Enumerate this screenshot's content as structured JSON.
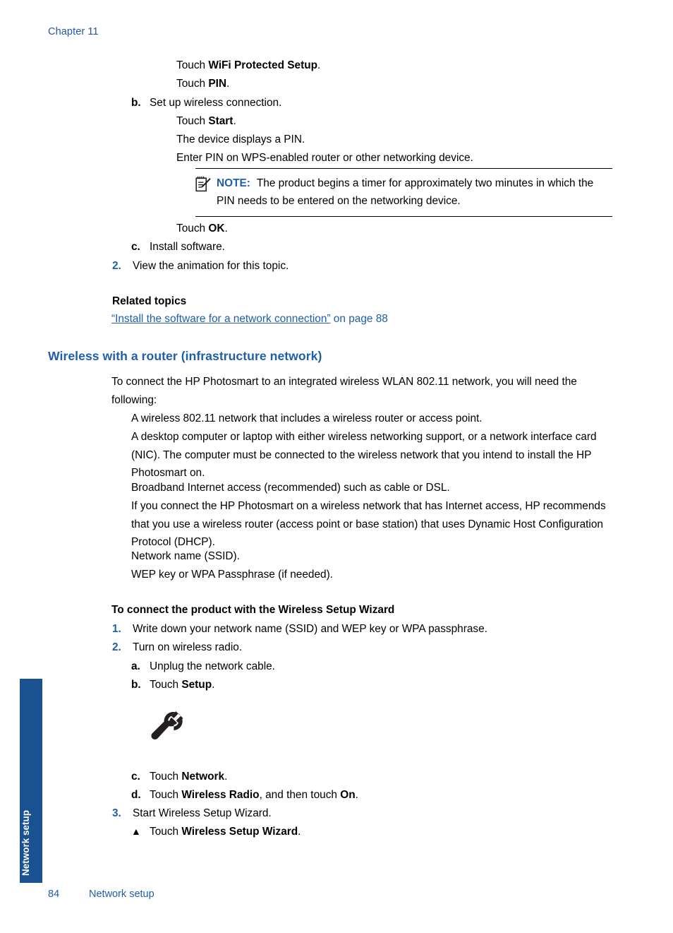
{
  "header": {
    "chapter": "Chapter 11"
  },
  "side_tab": {
    "label": "Network setup",
    "color": "#1A5190"
  },
  "colors": {
    "heading_blue": "#1F5FA9",
    "link_blue": "#1F5FA9",
    "chapter_blue": "#2156A5",
    "tab_blue": "#1A5190"
  },
  "top_steps": {
    "line_touch_wps": {
      "prefix": "Touch ",
      "bold": "WiFi Protected Setup",
      "suffix": "."
    },
    "line_touch_pin": {
      "prefix": "Touch ",
      "bold": "PIN",
      "suffix": "."
    },
    "step_b": {
      "marker": "b.",
      "text": "Set up wireless connection."
    },
    "line_touch_start": {
      "prefix": "Touch ",
      "bold": "Start",
      "suffix": "."
    },
    "line_device_pin": "The device displays a PIN.",
    "line_enter_pin": "Enter PIN on WPS-enabled router or other networking device.",
    "line_touch_ok": {
      "prefix": "Touch ",
      "bold": "OK",
      "suffix": "."
    },
    "step_c": {
      "marker": "c.",
      "text": "Install software."
    },
    "step_2": {
      "marker": "2.",
      "text": "View the animation for this topic."
    }
  },
  "note": {
    "icon": "note-pencil-icon",
    "label": "NOTE:",
    "text": "The product begins a timer for approximately two minutes in which the PIN needs to be entered on the networking device."
  },
  "related_topics": {
    "heading": "Related topics",
    "link_text": "“Install the software for a network connection”",
    "link_suffix": " on page 88"
  },
  "section": {
    "heading": "Wireless with a router (infrastructure network)",
    "intro": "To connect the HP Photosmart to an integrated wireless WLAN 802.11 network, you will need the following:",
    "requirements": [
      "A wireless 802.11 network that includes a wireless router or access point.",
      "A desktop computer or laptop with either wireless networking support, or a network interface card (NIC). The computer must be connected to the wireless network that you intend to install the HP Photosmart on.",
      "Broadband Internet access (recommended) such as cable or DSL.",
      "If you connect the HP Photosmart on a wireless network that has Internet access, HP recommends that you use a wireless router (access point or base station) that uses Dynamic Host Configuration Protocol (DHCP).",
      "Network name (SSID).",
      "WEP key or WPA Passphrase (if needed)."
    ]
  },
  "wizard": {
    "heading": "To connect the product with the Wireless Setup Wizard",
    "step_1": {
      "marker": "1.",
      "text": "Write down your network name (SSID) and WEP key or WPA passphrase."
    },
    "step_2": {
      "marker": "2.",
      "text": "Turn on wireless radio."
    },
    "step_2a": {
      "marker": "a.",
      "text": "Unplug the network cable."
    },
    "step_2b": {
      "marker": "b.",
      "prefix": "Touch ",
      "bold": "Setup",
      "suffix": "."
    },
    "wrench_icon": "wrench-icon",
    "step_2c": {
      "marker": "c.",
      "prefix": "Touch ",
      "bold": "Network",
      "suffix": "."
    },
    "step_2d": {
      "marker": "d.",
      "prefix": "Touch ",
      "bold": "Wireless Radio",
      "mid": ", and then touch ",
      "bold2": "On",
      "suffix": "."
    },
    "step_3": {
      "marker": "3.",
      "text": "Start Wireless Setup Wizard."
    },
    "step_3a": {
      "marker": "▲",
      "prefix": "Touch ",
      "bold": "Wireless Setup Wizard",
      "suffix": "."
    }
  },
  "footer": {
    "page_number": "84",
    "section_name": "Network setup"
  }
}
